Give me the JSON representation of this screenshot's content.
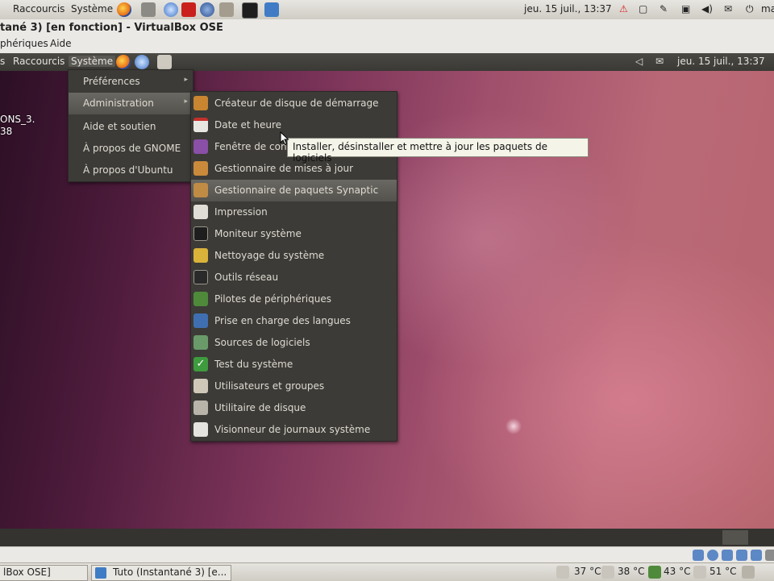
{
  "host_panel": {
    "menus": [
      "Raccourcis",
      "Système"
    ],
    "clock": "jeu. 15 juil., 13:37",
    "user": "ma"
  },
  "vbox_window": {
    "title": "tané 3) [en fonction] - VirtualBox OSE",
    "menus": [
      "phériques",
      "Aide"
    ]
  },
  "guest_panel": {
    "menus": [
      "s",
      "Raccourcis",
      "Système"
    ],
    "clock": "jeu. 15 juil., 13:37"
  },
  "desktop_icon": {
    "label_line1": "ONS_3.",
    "label_line2": "38"
  },
  "system_menu": {
    "items": [
      {
        "label": "Préférences",
        "submenu": true
      },
      {
        "label": "Administration",
        "submenu": true,
        "highlighted": true
      },
      {
        "label": "Aide et soutien"
      },
      {
        "label": "À propos de GNOME"
      },
      {
        "label": "À propos d'Ubuntu"
      }
    ]
  },
  "admin_menu": {
    "items": [
      {
        "label": "Créateur de disque de démarrage",
        "icon": "usb-disk-icon"
      },
      {
        "label": "Date et heure",
        "icon": "calendar-icon"
      },
      {
        "label": "Fenêtre de connexion",
        "icon": "login-window-icon"
      },
      {
        "label": "Gestionnaire de mises à jour",
        "icon": "update-manager-icon"
      },
      {
        "label": "Gestionnaire de paquets Synaptic",
        "icon": "package-icon",
        "highlighted": true
      },
      {
        "label": "Impression",
        "icon": "printer-icon"
      },
      {
        "label": "Moniteur système",
        "icon": "system-monitor-icon"
      },
      {
        "label": "Nettoyage du système",
        "icon": "broom-icon"
      },
      {
        "label": "Outils réseau",
        "icon": "network-tools-icon"
      },
      {
        "label": "Pilotes de périphériques",
        "icon": "driver-card-icon"
      },
      {
        "label": "Prise en charge des langues",
        "icon": "language-icon"
      },
      {
        "label": "Sources de logiciels",
        "icon": "software-sources-icon"
      },
      {
        "label": "Test du système",
        "icon": "checkmark-icon"
      },
      {
        "label": "Utilisateurs et groupes",
        "icon": "users-icon"
      },
      {
        "label": "Utilitaire de disque",
        "icon": "disk-utility-icon"
      },
      {
        "label": "Visionneur de journaux système",
        "icon": "log-viewer-icon"
      }
    ]
  },
  "tooltip": {
    "text": "Installer, désinstaller et mettre à jour les paquets de logiciels"
  },
  "host_taskbar": {
    "tasks": [
      "lBox OSE]",
      "Tuto (Instantané 3) [e..."
    ],
    "temps": [
      "37 °C",
      "38 °C",
      "43 °C",
      "51 °C"
    ]
  },
  "colors": {
    "menu_bg": "#3c3b37",
    "menu_text": "#dfdbd2",
    "highlight": "#5f5d57",
    "tooltip_bg": "#f5f4e9"
  }
}
